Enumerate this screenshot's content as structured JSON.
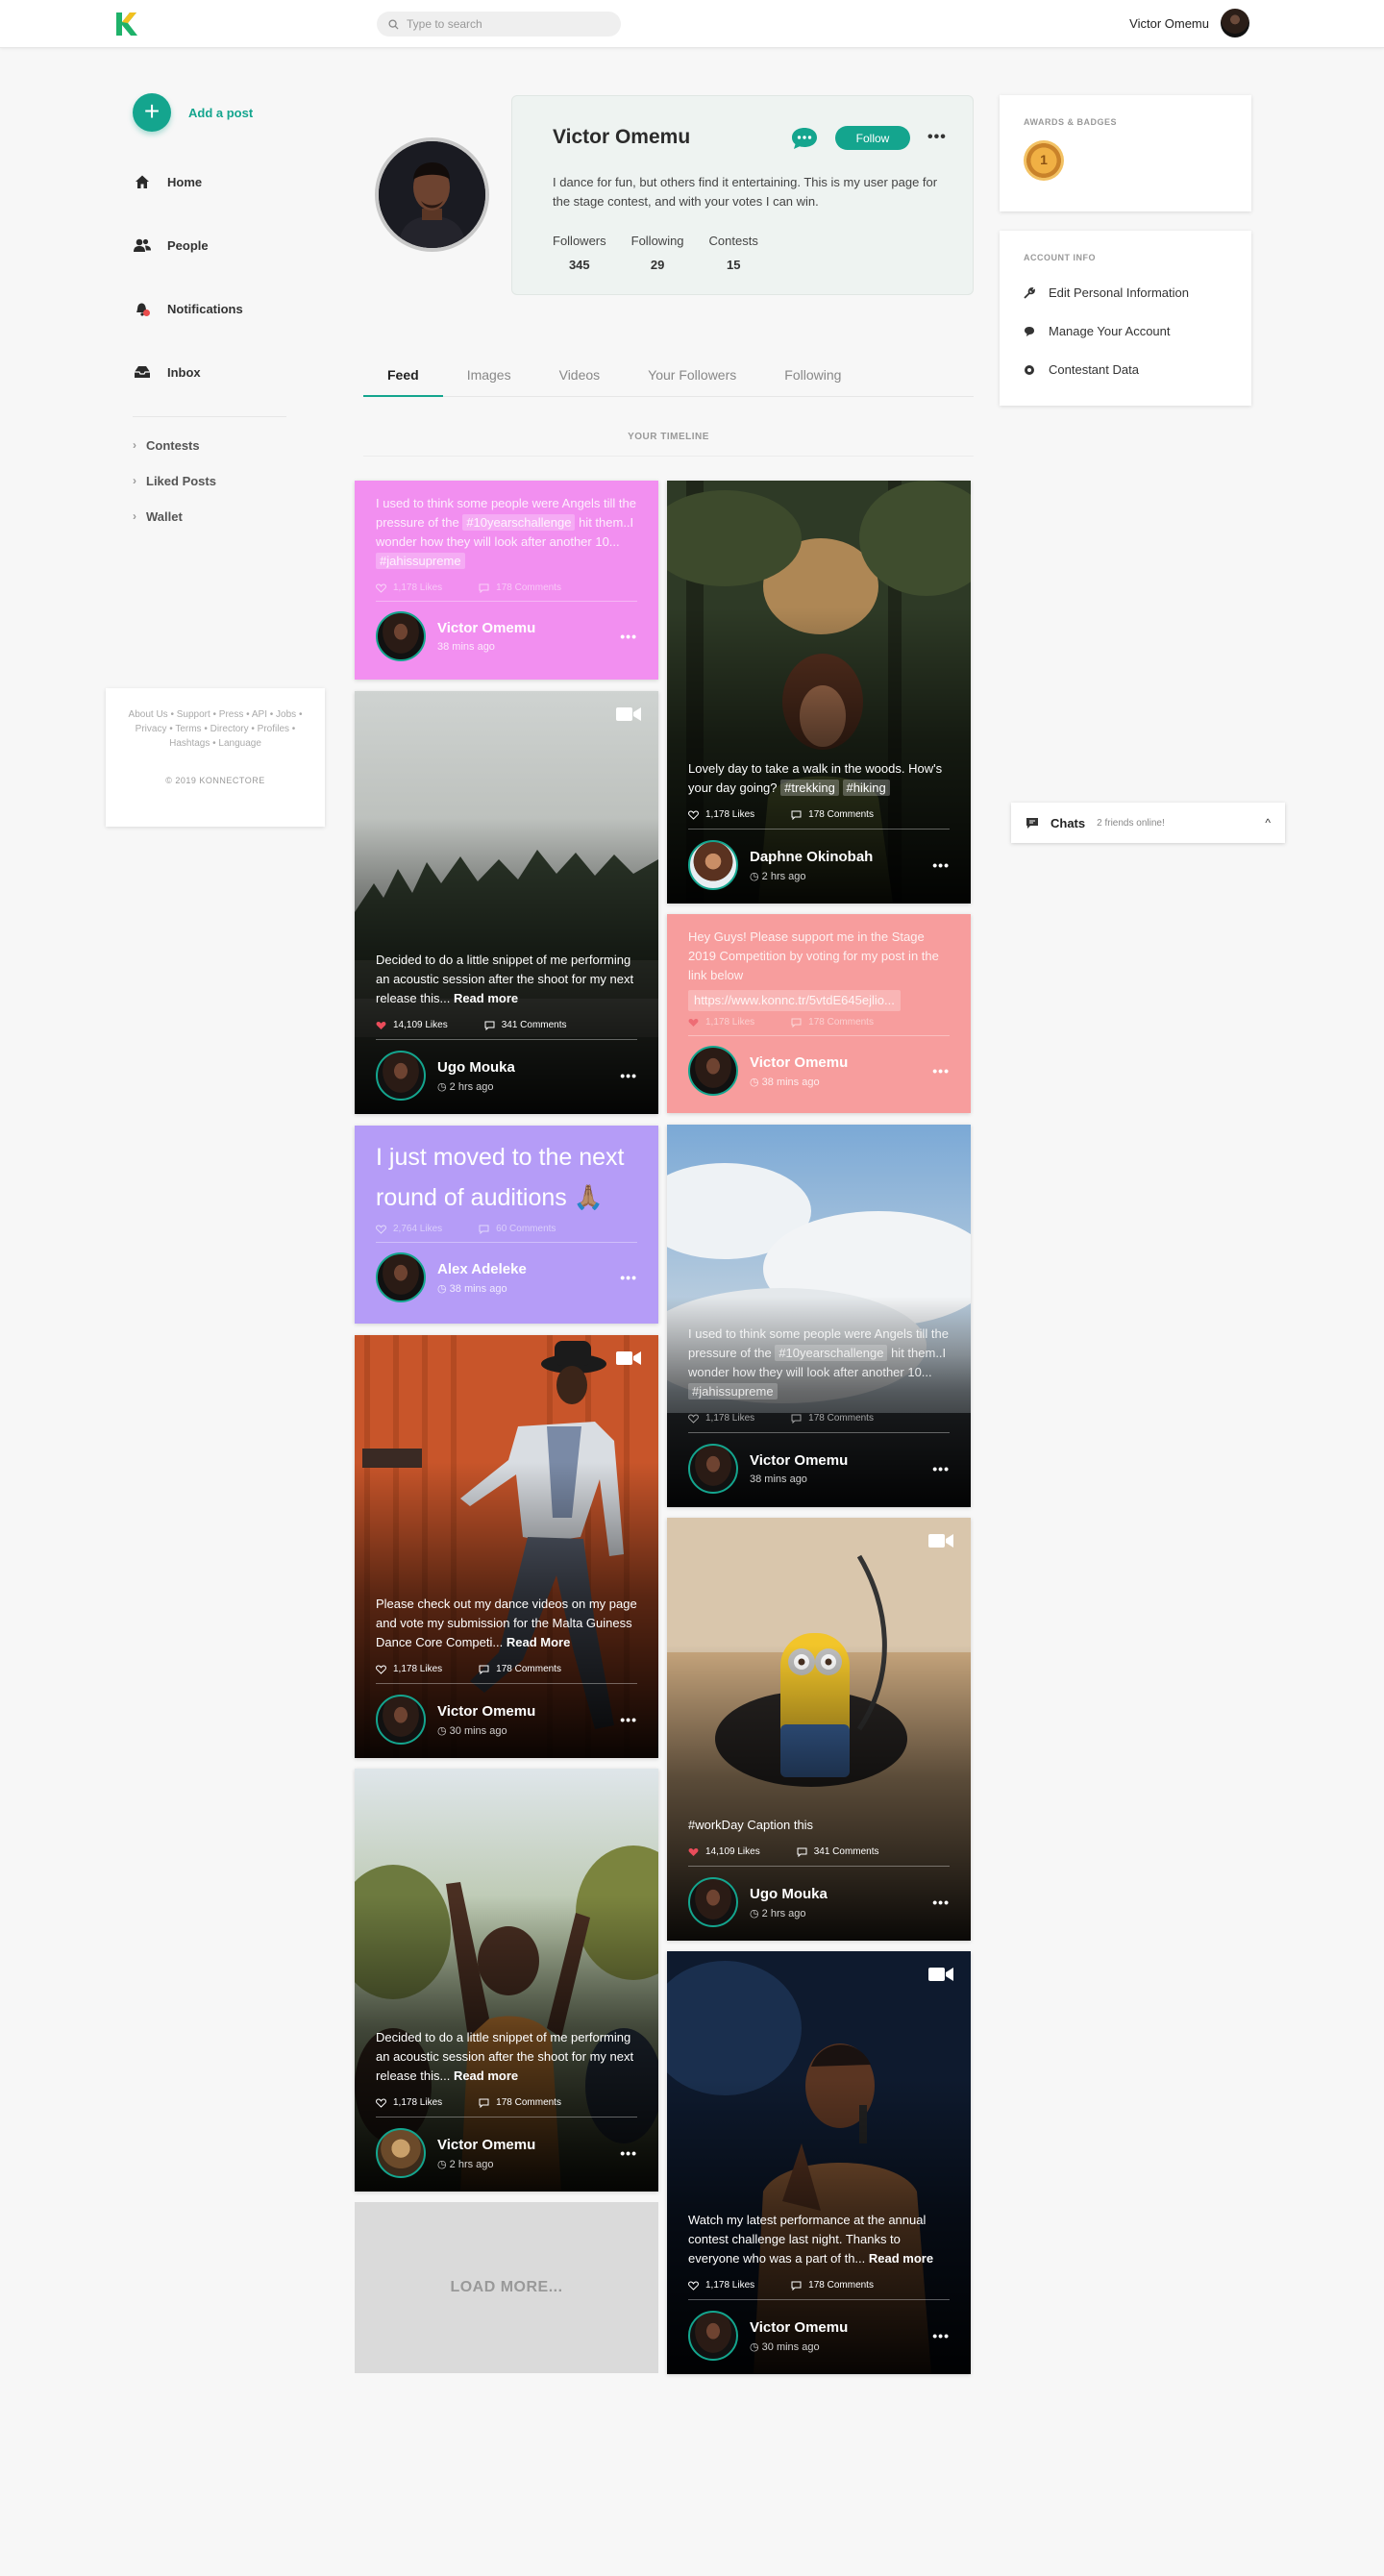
{
  "topbar": {
    "search_placeholder": "Type to search",
    "user_name": "Victor Omemu"
  },
  "nav": {
    "add_post": "Add a post",
    "items": [
      {
        "label": "Home",
        "icon": "home-icon"
      },
      {
        "label": "People",
        "icon": "people-icon"
      },
      {
        "label": "Notifications",
        "icon": "bell-icon"
      },
      {
        "label": "Inbox",
        "icon": "inbox-icon"
      }
    ],
    "sub_items": [
      "Contests",
      "Liked Posts",
      "Wallet"
    ]
  },
  "footer": {
    "links": "About Us • Support • Press • API • Jobs • Privacy • Terms • Directory • Profiles • Hashtags • Language",
    "copyright": "© 2019 KONNECTORE"
  },
  "profile": {
    "name": "Victor Omemu",
    "follow_label": "Follow",
    "bio": "I dance for fun, but others find it entertaining. This is my user page for the stage contest, and with your votes I can win.",
    "stats": [
      {
        "label": "Followers",
        "value": "345"
      },
      {
        "label": "Following",
        "value": "29"
      },
      {
        "label": "Contests",
        "value": "15"
      }
    ]
  },
  "tabs": [
    "Feed",
    "Images",
    "Videos",
    "Your Followers",
    "Following"
  ],
  "timeline_label": "YOUR TIMELINE",
  "awards": {
    "title": "AWARDS & BADGES",
    "medal": "1"
  },
  "account": {
    "title": "ACCOUNT INFO",
    "items": [
      {
        "label": "Edit Personal Information",
        "icon": "wrench-icon"
      },
      {
        "label": "Manage Your Account",
        "icon": "comment-icon"
      },
      {
        "label": "Contestant Data",
        "icon": "circle-icon"
      }
    ]
  },
  "chats": {
    "title": "Chats",
    "status": "2 friends online!"
  },
  "posts": [
    {
      "caption_a": "I used to think some people were Angels till the pressure of the ",
      "tag1": "#10yearschallenge",
      "caption_b": " hit them..I wonder how they will look after another 10... ",
      "tag2": "#jahissupreme",
      "likes": "1,178 Likes",
      "comments": "178 Comments",
      "name": "Victor Omemu",
      "time": "38 mins ago"
    },
    {
      "caption": "Lovely day to take a walk in the woods. How's your day going? ",
      "tag1": "#trekking",
      "tag2": "#hiking",
      "likes": "1,178 Likes",
      "comments": "178 Comments",
      "name": "Daphne Okinobah",
      "time": "2 hrs ago"
    },
    {
      "caption": "Decided to do a little snippet of me performing an acoustic session after the shoot for my next release this... ",
      "read_more": "Read more",
      "likes": "14,109 Likes",
      "comments": "341 Comments",
      "name": "Ugo Mouka",
      "time": "2 hrs ago"
    },
    {
      "caption": "Hey Guys! Please support me in the Stage 2019 Competition by voting for my post in the link below",
      "link": "https://www.konnc.tr/5vtdE645ejlio...",
      "likes": "1,178 Likes",
      "comments": "178 Comments",
      "name": "Victor Omemu",
      "time": "38 mins ago"
    },
    {
      "caption": "I just moved to the next round of auditions 🙏🏽",
      "likes": "2,764 Likes",
      "comments": "60 Comments",
      "name": "Alex Adeleke",
      "time": "38 mins ago"
    },
    {
      "caption_a": "I used to think some people were Angels till the pressure of the ",
      "tag1": "#10yearschallenge",
      "caption_b": " hit them..I wonder how they will look after another 10... ",
      "tag2": "#jahissupreme",
      "likes": "1,178 Likes",
      "comments": "178 Comments",
      "name": "Victor Omemu",
      "time": "38 mins ago"
    },
    {
      "caption": "Please check out my dance videos on my page and vote my submission for the Malta Guiness Dance Core Competi... ",
      "read_more": "Read More",
      "likes": "1,178 Likes",
      "comments": "178 Comments",
      "name": "Victor Omemu",
      "time": "30 mins ago"
    },
    {
      "caption": "#workDay   Caption this",
      "likes": "14,109 Likes",
      "comments": "341 Comments",
      "name": "Ugo Mouka",
      "time": "2 hrs ago"
    },
    {
      "caption": "Decided to do a little snippet of me performing an acoustic session after the shoot for my next release this... ",
      "read_more": "Read more",
      "likes": "1,178 Likes",
      "comments": "178 Comments",
      "name": "Victor Omemu",
      "time": "2 hrs ago"
    },
    {
      "caption": "Watch my latest performance at the annual contest challenge last night. Thanks to everyone who was a part of th... ",
      "read_more": "Read more",
      "likes": "1,178 Likes",
      "comments": "178 Comments",
      "name": "Victor Omemu",
      "time": "30 mins ago"
    }
  ],
  "load_more": "LOAD MORE...",
  "colors": {
    "accent": "#14a58e",
    "pink": "#f28ff0",
    "salmon": "#f79d9d",
    "purple": "#b59cf7"
  }
}
